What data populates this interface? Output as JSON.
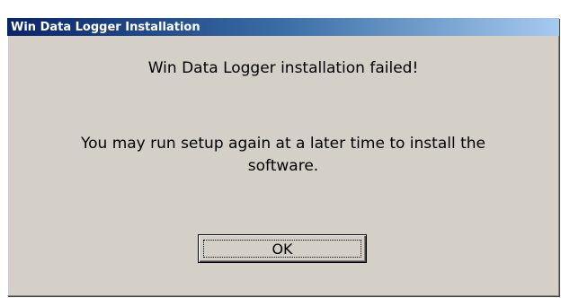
{
  "window": {
    "title": "Win Data Logger Installation"
  },
  "message": {
    "line1": "Win Data Logger installation failed!",
    "line2": "You may run setup again at a later time to install the",
    "line3": "software."
  },
  "buttons": {
    "ok_label": "OK"
  }
}
